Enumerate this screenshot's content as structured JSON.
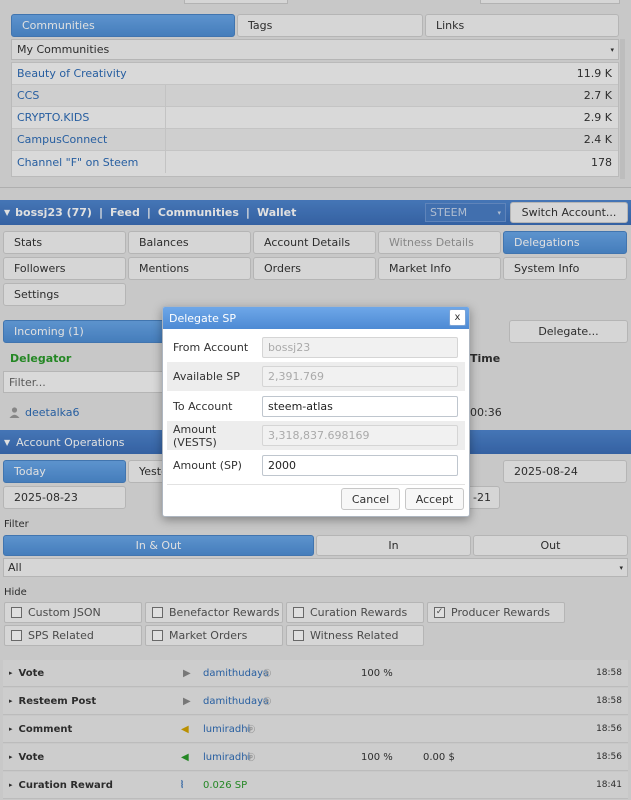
{
  "communities_panel": {
    "tabs": [
      "Communities",
      "Tags",
      "Links"
    ],
    "dropdown": "My Communities",
    "items": [
      {
        "name": "Beauty of Creativity",
        "count": "11.9 K"
      },
      {
        "name": "CCS",
        "count": "2.7 K"
      },
      {
        "name": "CRYPTO.KIDS",
        "count": "2.9 K"
      },
      {
        "name": "CampusConnect",
        "count": "2.4 K"
      },
      {
        "name": "Channel \"F\" on Steem",
        "count": "178"
      }
    ]
  },
  "account_bar": {
    "user": "bossj23 (77)",
    "links": [
      "Feed",
      "Communities",
      "Wallet"
    ],
    "sep": "|",
    "currency": "STEEM",
    "switch_label": "Switch Account..."
  },
  "account_tabs": [
    "Stats",
    "Balances",
    "Account Details",
    "Witness Details",
    "Delegations",
    "Followers",
    "Mentions",
    "Orders",
    "Market Info",
    "System Info",
    "Settings"
  ],
  "delegations": {
    "incoming_tab": "Incoming (1)",
    "delegate_button": "Delegate...",
    "col_delegator": "Delegator",
    "col_time": "Time",
    "filter_placeholder": "Filter...",
    "row_name": "deetalka6",
    "row_time": "00:36"
  },
  "operations": {
    "title": "Account Operations",
    "dates": [
      "Today",
      "Yeste",
      "2025-08-24",
      "2025-08-23",
      "-21"
    ],
    "filter_label": "Filter",
    "filter_tabs": [
      "In & Out",
      "In",
      "Out"
    ],
    "filter_select": "All",
    "hide_label": "Hide",
    "hide_options": [
      {
        "label": "Custom JSON",
        "checked": false
      },
      {
        "label": "Benefactor Rewards",
        "checked": false
      },
      {
        "label": "Curation Rewards",
        "checked": false
      },
      {
        "label": "Producer Rewards",
        "checked": true
      },
      {
        "label": "SPS Related",
        "checked": false
      },
      {
        "label": "Market Orders",
        "checked": false
      },
      {
        "label": "Witness Related",
        "checked": false
      }
    ],
    "rows": [
      {
        "type": "Vote",
        "arrow": "right",
        "user": "damithudaya",
        "pct": "100 %",
        "amount": "",
        "time": "18:58"
      },
      {
        "type": "Resteem Post",
        "arrow": "right",
        "user": "damithudaya",
        "pct": "",
        "amount": "",
        "time": "18:58"
      },
      {
        "type": "Comment",
        "arrow": "left",
        "user": "lumiradhi",
        "pct": "",
        "amount": "",
        "time": "18:56"
      },
      {
        "type": "Vote",
        "arrow": "left-green",
        "user": "lumiradhi",
        "pct": "100 %",
        "amount": "0.00 $",
        "time": "18:56"
      },
      {
        "type": "Curation Reward",
        "arrow": "steem",
        "user": "0.026 SP",
        "pct": "",
        "amount": "",
        "time": "18:41"
      }
    ]
  },
  "modal": {
    "title": "Delegate SP",
    "close": "x",
    "from_label": "From Account",
    "from_value": "bossj23",
    "available_label": "Available SP",
    "available_value": "2,391.769",
    "to_label": "To Account",
    "to_value": "steem-atlas",
    "vests_label": "Amount (VESTS)",
    "vests_value": "3,318,837.698169",
    "sp_label": "Amount (SP)",
    "sp_value": "2000",
    "cancel": "Cancel",
    "accept": "Accept"
  },
  "colors": {
    "accent": "#4f8fd6",
    "header": "#3c6fb9",
    "link": "#2d6cb7",
    "green": "#2a9a2a"
  }
}
